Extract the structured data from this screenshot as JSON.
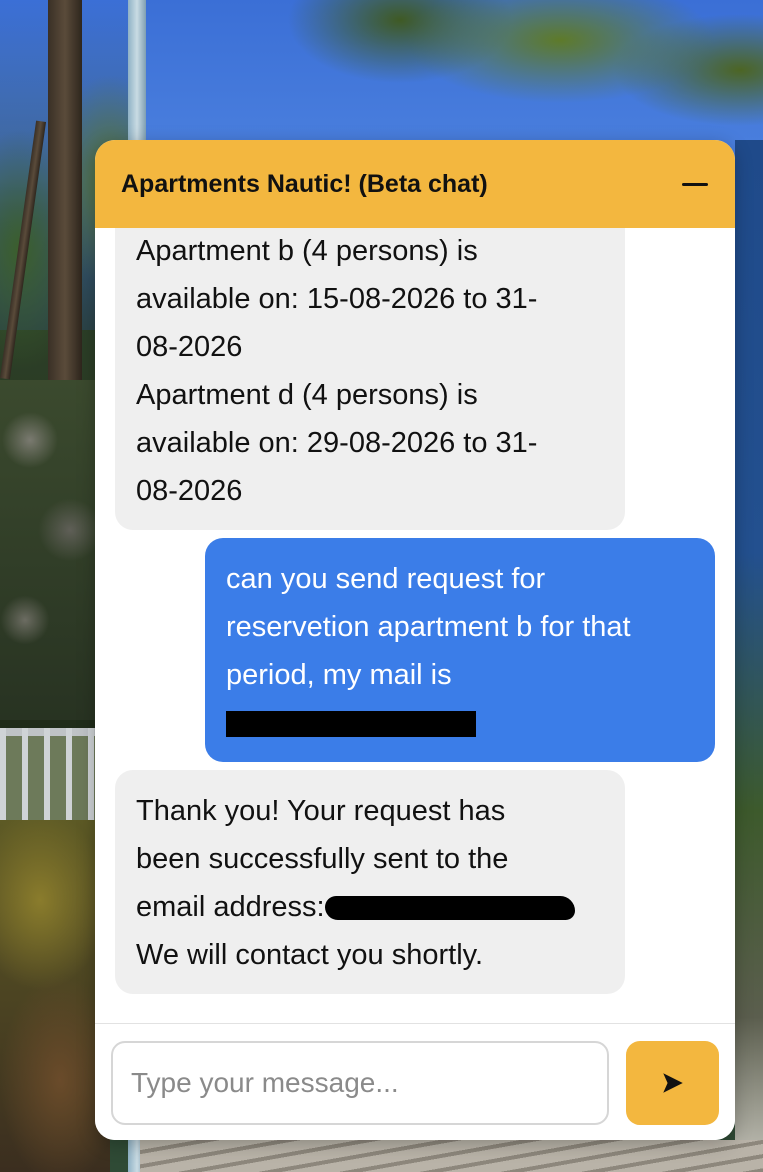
{
  "chat": {
    "title": "Apartments Nautic! (Beta chat)",
    "minimize_label": "—"
  },
  "messages": [
    {
      "sender": "bot",
      "lines": [
        "Apartment b (4 persons) is",
        "available on: 15-08-2026 to 31-",
        "08-2026",
        "Apartment d (4 persons) is",
        "available on: 29-08-2026 to 31-",
        "08-2026"
      ]
    },
    {
      "sender": "user",
      "lines": [
        "can you send request for",
        "reservetion apartment b for that",
        "period, my mail is"
      ],
      "redacted_email": true
    },
    {
      "sender": "bot",
      "lines": [
        "Thank you! Your request has",
        "been successfully sent to the",
        "email address:",
        "We will contact you shortly."
      ],
      "redacted_email": true
    }
  ],
  "input": {
    "placeholder": "Type your message...",
    "value": ""
  },
  "send": {
    "icon": "send-arrow-icon"
  },
  "colors": {
    "header": "#f3b73f",
    "user_bubble": "#3b7de8",
    "bot_bubble": "#efefef",
    "send_button": "#f3b73f"
  }
}
